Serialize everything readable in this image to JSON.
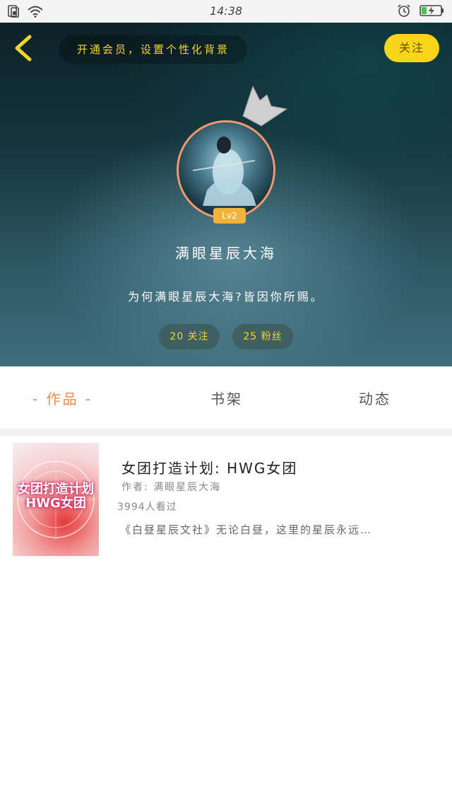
{
  "status_bar": {
    "time": "14:38",
    "icons": [
      "sim-icon",
      "wifi-icon",
      "alarm-icon",
      "battery-charging-icon"
    ]
  },
  "header": {
    "notice_text": "开通会员，设置个性化背景",
    "follow_label": "关注",
    "avatar_level": "Lv2",
    "username": "满眼星辰大海",
    "bio": "为何满眼星辰大海?皆因你所赐。",
    "stats": {
      "following_count": "20",
      "following_label": "关注",
      "fans_count": "25",
      "fans_label": "粉丝"
    }
  },
  "tabs": {
    "works": "- 作品 -",
    "shelf": "书架",
    "feed": "动态"
  },
  "works": [
    {
      "title": "女团打造计划: HWG女团",
      "author": "作者: 满眼星辰大海",
      "views": "3994人看过",
      "description": "《白昼星辰文社》无论白昼，这里的星辰永远…",
      "cover_text": "女团打造计划 HWG女团"
    }
  ],
  "colors": {
    "accent_orange": "#ef8a4c",
    "follow_yellow": "#f7d51a",
    "stat_yellow": "#f5d430"
  }
}
